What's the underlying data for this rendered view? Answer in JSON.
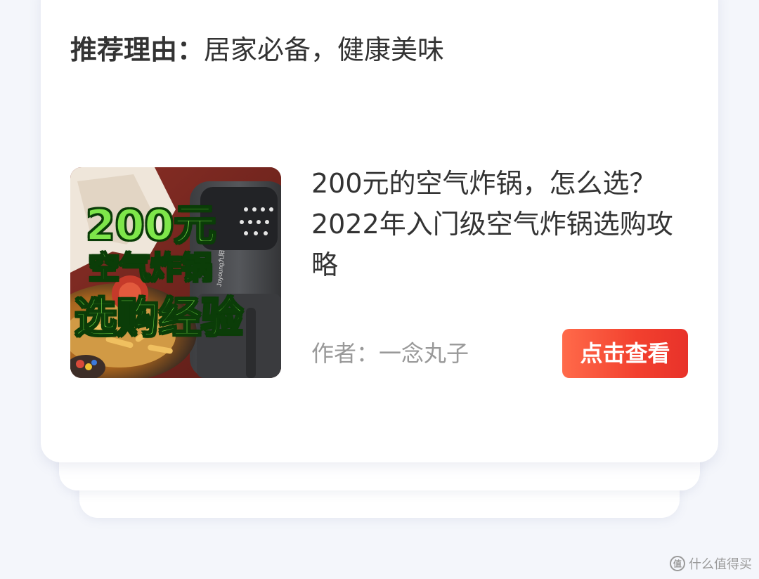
{
  "card": {
    "reason_label": "推荐理由：",
    "reason_text": "居家必备，健康美味"
  },
  "article": {
    "thumbnail": {
      "line1": "200元",
      "line2": "空气炸锅",
      "line3": "选购经验",
      "brand": "Joyoung九阳"
    },
    "title": "200元的空气炸锅，怎么选？2022年入门级空气炸锅选购攻略",
    "author": "作者：一念丸子",
    "view_button": "点击查看"
  },
  "watermark": {
    "text": "什么值得买"
  },
  "colors": {
    "button_start": "#ff6a4a",
    "button_end": "#e8322a",
    "text_primary": "#333333",
    "text_secondary": "#999999",
    "thumb_text": "#7ee64a"
  }
}
